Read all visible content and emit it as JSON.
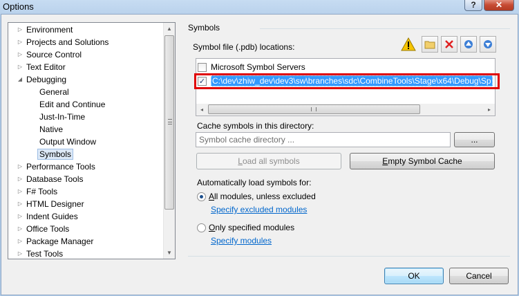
{
  "window": {
    "title": "Options",
    "help_label": "?",
    "close_label": "✕"
  },
  "tree": {
    "items": [
      {
        "label": "Environment",
        "arrow": "▷"
      },
      {
        "label": "Projects and Solutions",
        "arrow": "▷"
      },
      {
        "label": "Source Control",
        "arrow": "▷"
      },
      {
        "label": "Text Editor",
        "arrow": "▷"
      },
      {
        "label": "Debugging",
        "arrow": "◢"
      },
      {
        "label": "General",
        "arrow": ""
      },
      {
        "label": "Edit and Continue",
        "arrow": ""
      },
      {
        "label": "Just-In-Time",
        "arrow": ""
      },
      {
        "label": "Native",
        "arrow": ""
      },
      {
        "label": "Output Window",
        "arrow": ""
      },
      {
        "label": "Symbols",
        "arrow": ""
      },
      {
        "label": "Performance Tools",
        "arrow": "▷"
      },
      {
        "label": "Database Tools",
        "arrow": "▷"
      },
      {
        "label": "F# Tools",
        "arrow": "▷"
      },
      {
        "label": "HTML Designer",
        "arrow": "▷"
      },
      {
        "label": "Indent Guides",
        "arrow": "▷"
      },
      {
        "label": "Office Tools",
        "arrow": "▷"
      },
      {
        "label": "Package Manager",
        "arrow": "▷"
      },
      {
        "label": "Test Tools",
        "arrow": "▷"
      }
    ],
    "selected": "Symbols",
    "scroll_up": "▲",
    "scroll_down": "▼"
  },
  "symbols": {
    "section_title": "Symbols",
    "locations_label": "Symbol file (.pdb) locations:",
    "toolbar_icons": [
      "warning-icon",
      "folder-icon",
      "delete-icon",
      "move-up-icon",
      "move-down-icon"
    ],
    "locations": [
      {
        "label": "Microsoft Symbol Servers",
        "checked": false,
        "check": ""
      },
      {
        "label": "C:\\dev\\zhiw_dev\\dev3\\sw\\branches\\sdc\\CombineTools\\Stage\\x64\\Debug\\Sp",
        "checked": true,
        "check": "✓"
      }
    ],
    "hscroll_left": "◂",
    "hscroll_right": "▸",
    "cache_label": "Cache symbols in this directory:",
    "cache_placeholder": "Symbol cache directory ...",
    "browse_label": "...",
    "load_all_prefix": "",
    "load_all_hotkey": "L",
    "load_all_rest": "oad all symbols",
    "empty_cache_prefix": "",
    "empty_cache_hotkey": "E",
    "empty_cache_rest": "mpty Symbol Cache",
    "auto_load_label": "Automatically load symbols for:",
    "option_all_hotkey": "A",
    "option_all_rest": "ll modules, unless excluded",
    "option_all_selected": true,
    "specify_excluded_link": "Specify excluded modules",
    "option_only_hotkey": "O",
    "option_only_rest": "nly specified modules",
    "option_only_selected": false,
    "specify_modules_link": "Specify modules"
  },
  "footer": {
    "ok_label": "OK",
    "cancel_label": "Cancel"
  },
  "colors": {
    "highlight_border": "#e00000",
    "selection": "#3399ff",
    "link": "#0066cc"
  }
}
